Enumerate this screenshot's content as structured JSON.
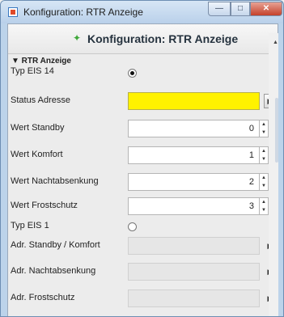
{
  "window": {
    "title": "Konfiguration: RTR Anzeige"
  },
  "header": {
    "title": "Konfiguration: RTR Anzeige"
  },
  "section": {
    "label": "▼ RTR Anzeige"
  },
  "rows": {
    "typ_eis14": {
      "label": "Typ EIS 14",
      "selected": true
    },
    "status_adresse": {
      "label": "Status Adresse",
      "value": ""
    },
    "wert_standby": {
      "label": "Wert Standby",
      "value": "0"
    },
    "wert_komfort": {
      "label": "Wert Komfort",
      "value": "1"
    },
    "wert_nacht": {
      "label": "Wert Nachtabsenkung",
      "value": "2"
    },
    "wert_frost": {
      "label": "Wert Frostschutz",
      "value": "3"
    },
    "typ_eis1": {
      "label": "Typ EIS 1",
      "selected": false
    },
    "adr_standby": {
      "label": "Adr. Standby / Komfort",
      "value": ""
    },
    "adr_nacht": {
      "label": "Adr. Nachtabsenkung",
      "value": ""
    },
    "adr_frost": {
      "label": "Adr. Frostschutz",
      "value": ""
    }
  },
  "icons": {
    "app": "app-icon",
    "header": "sparkle-icon",
    "arrow": "triangle-right-icon",
    "spin_up": "spin-up-icon",
    "spin_down": "spin-down-icon"
  },
  "colors": {
    "status_field": "#fff200",
    "titlebar": "#bcd3ea",
    "close": "#c4412a"
  }
}
